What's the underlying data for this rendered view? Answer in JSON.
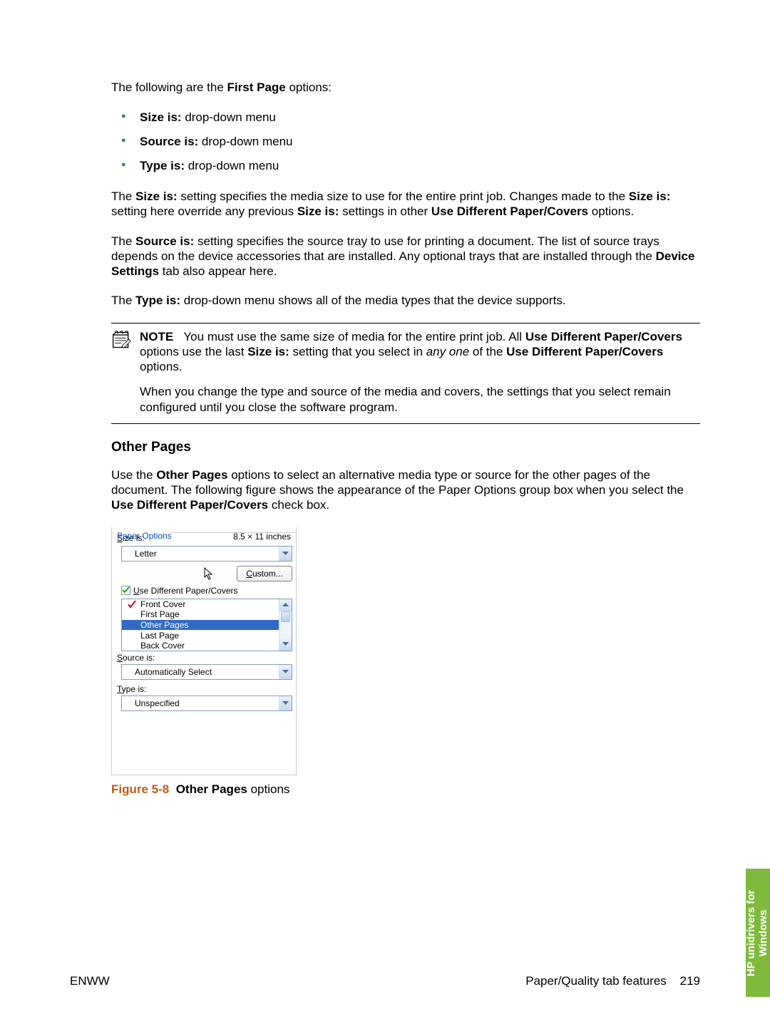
{
  "intro": "The following are the ",
  "intro_bold": "First Page",
  "intro_tail": " options:",
  "bullets": [
    {
      "bold": "Size is:",
      "rest": " drop-down menu"
    },
    {
      "bold": "Source is:",
      "rest": " drop-down menu"
    },
    {
      "bold": "Type is:",
      "rest": " drop-down menu"
    }
  ],
  "para1": {
    "a": "The ",
    "b": "Size is:",
    "c": " setting specifies the media size to use for the entire print job. Changes made to the ",
    "d": "Size is:",
    "e": " setting here override any previous ",
    "f": "Size is:",
    "g": " settings in other ",
    "h": "Use Different Paper/Covers",
    "i": " options."
  },
  "para2": {
    "a": "The ",
    "b": "Source is:",
    "c": " setting specifies the source tray to use for printing a document. The list of source trays depends on the device accessories that are installed. Any optional trays that are installed through the ",
    "d": "Device Settings",
    "e": " tab also appear here."
  },
  "para3": {
    "a": "The ",
    "b": "Type is:",
    "c": " drop-down menu shows all of the media types that the device supports."
  },
  "note": {
    "label": "NOTE",
    "p1a": "You must use the same size of media for the entire print job. All ",
    "p1b": "Use Different Paper/Covers",
    "p1c": " options use the last ",
    "p1d": "Size is:",
    "p1e": " setting that you select in ",
    "p1f": "any one",
    "p1g": " of the ",
    "p1h": "Use Different Paper/Covers",
    "p1i": " options.",
    "p2": "When you change the type and source of the media and covers, the settings that you select remain configured until you close the software program."
  },
  "section_title": "Other Pages",
  "section_para": {
    "a": "Use the ",
    "b": "Other Pages",
    "c": " options to select an alternative media type or source for the other pages of the document. The following figure shows the appearance of the Paper Options group box when you select the ",
    "d": "Use Different Paper/Covers",
    "e": " check box."
  },
  "paper_options": {
    "group_title": "Paper Options",
    "size_label": "Size is:",
    "dimensions": "8.5 × 11 inches",
    "size_value": "Letter",
    "custom_btn": "Custom...",
    "checkbox_label": "Use Different Paper/Covers",
    "list_items": [
      "Front Cover",
      "First Page",
      "Other Pages",
      "Last Page",
      "Back Cover"
    ],
    "selected_index": 2,
    "checked_index": 0,
    "source_label": "Source is:",
    "source_value": "Automatically Select",
    "type_label": "Type is:",
    "type_value": "Unspecified"
  },
  "figure": {
    "label": "Figure 5-8",
    "bold_caption": "Other Pages",
    "rest": " options"
  },
  "footer": {
    "left": "ENWW",
    "right_text": "Paper/Quality tab features",
    "page_num": "219"
  },
  "side_tab": "HP unidrivers for\nWindows"
}
